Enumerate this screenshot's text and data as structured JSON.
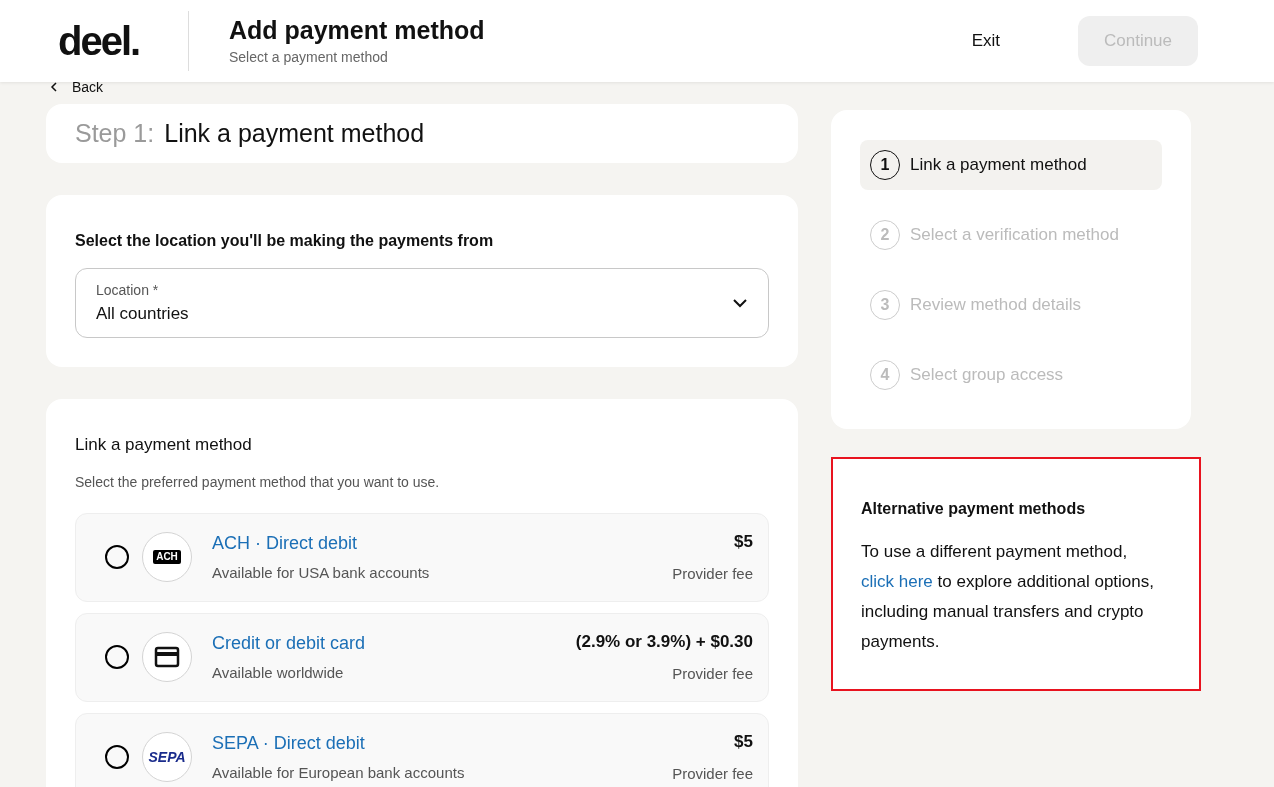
{
  "header": {
    "logo": "deel.",
    "title": "Add payment method",
    "subtitle": "Select a payment method",
    "exit": "Exit",
    "continue": {
      "label": "Continue",
      "disabled": true
    }
  },
  "back": "Back",
  "step": {
    "prefix": "Step 1:",
    "title": "Link a payment method"
  },
  "location": {
    "heading": "Select the location you'll be making the payments from",
    "label": "Location *",
    "value": "All countries"
  },
  "methods_section": {
    "title": "Link a payment method",
    "subtitle": "Select the preferred payment method that you want to use.",
    "methods": [
      {
        "kind": "ach",
        "logo": "ACH",
        "name": "ACH · Direct debit",
        "description": "Available for USA bank accounts",
        "fee": "$5",
        "fee_label": "Provider fee",
        "selected": false
      },
      {
        "kind": "card",
        "name": "Credit or debit card",
        "description": "Available worldwide",
        "fee": "(2.9% or 3.9%) + $0.30",
        "fee_label": "Provider fee",
        "selected": false
      },
      {
        "kind": "sepa",
        "logo": "SEPA",
        "name": "SEPA · Direct debit",
        "description": "Available for European bank accounts",
        "fee": "$5",
        "fee_label": "Provider fee",
        "selected": false
      }
    ]
  },
  "steps": [
    {
      "number": "1",
      "label": "Link a payment method",
      "selected": true
    },
    {
      "number": "2",
      "label": "Select a verification method",
      "selected": false
    },
    {
      "number": "3",
      "label": "Review method details",
      "selected": false
    },
    {
      "number": "4",
      "label": "Select group access",
      "selected": false
    }
  ],
  "alternative": {
    "title": "Alternative payment methods",
    "text_before": "To use a different payment method,",
    "link": "click here",
    "text_after": "to explore additional options, including manual transfers and crypto payments."
  }
}
